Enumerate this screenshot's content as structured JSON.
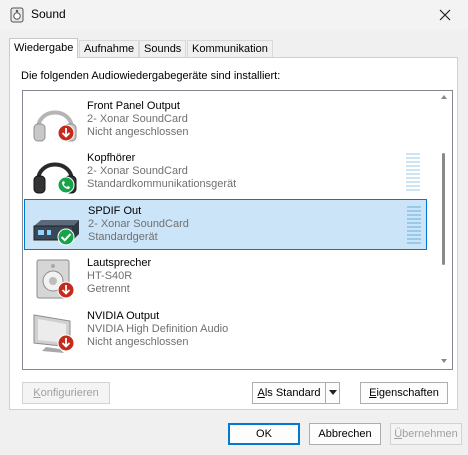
{
  "window": {
    "title": "Sound"
  },
  "tabs": [
    {
      "label": "Wiedergabe",
      "active": true
    },
    {
      "label": "Aufnahme",
      "active": false
    },
    {
      "label": "Sounds",
      "active": false
    },
    {
      "label": "Kommunikation",
      "active": false
    }
  ],
  "intro": "Die folgenden Audiowiedergabegeräte sind installiert:",
  "devices": [
    {
      "name": "Front Panel Output",
      "line1": "2- Xonar SoundCard",
      "line2": "Nicht angeschlossen",
      "icon": "headphones-icon",
      "status_icon": "disconnected-arrow-icon",
      "selected": false
    },
    {
      "name": "Kopfhörer",
      "line1": "2- Xonar SoundCard",
      "line2": "Standardkommunikationsgerät",
      "icon": "headphones-icon",
      "status_icon": "phone-check-icon",
      "selected": false
    },
    {
      "name": "SPDIF Out",
      "line1": "2- Xonar SoundCard",
      "line2": "Standardgerät",
      "icon": "spdif-device-icon",
      "status_icon": "checkmark-icon",
      "selected": true
    },
    {
      "name": "Lautsprecher",
      "line1": "HT-S40R",
      "line2": "Getrennt",
      "icon": "speaker-icon",
      "status_icon": "disconnected-arrow-icon",
      "selected": false
    },
    {
      "name": "NVIDIA Output",
      "line1": "NVIDIA High Definition Audio",
      "line2": "Nicht angeschlossen",
      "icon": "monitor-icon",
      "status_icon": "disconnected-arrow-icon",
      "selected": false
    }
  ],
  "buttons": {
    "configure_first": "K",
    "configure_rest": "onfigurieren",
    "set_default_first": "A",
    "set_default_rest": "ls Standard",
    "properties_first": "E",
    "properties_rest": "igenschaften",
    "ok": "OK",
    "cancel": "Abbrechen",
    "apply_first": "Ü",
    "apply_rest": "bernehmen"
  },
  "colors": {
    "accent": "#0078d4",
    "selection": "#cce4f7",
    "status_red": "#c42b1c",
    "status_green": "#16a34a"
  }
}
